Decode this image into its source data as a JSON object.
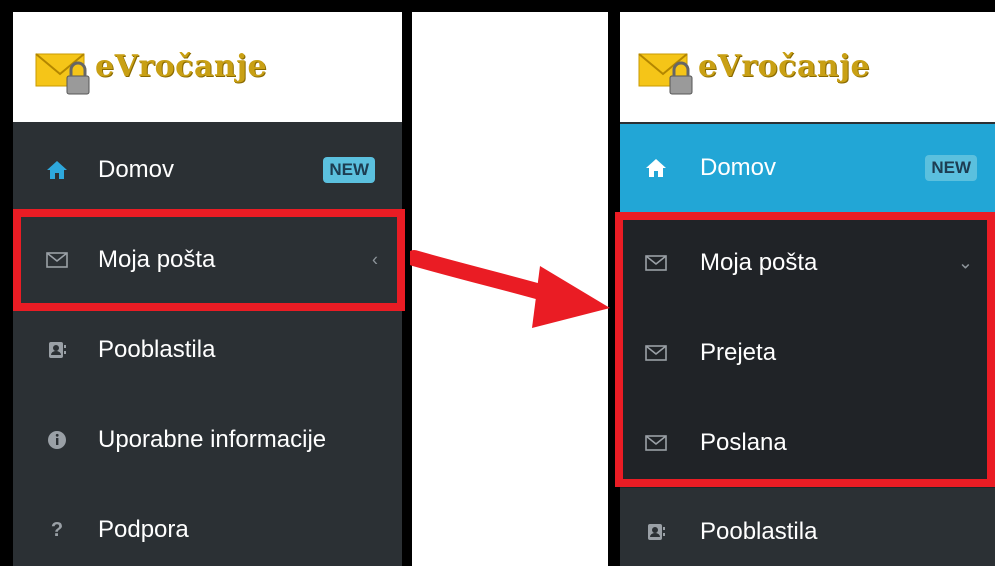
{
  "brand": {
    "name": "eVročanje",
    "logo_icon": "envelope-lock-icon"
  },
  "left_panel": {
    "items": [
      {
        "label": "Domov",
        "icon": "home-icon",
        "badge": "NEW"
      },
      {
        "label": "Moja pošta",
        "icon": "envelope-icon",
        "chevron": "‹"
      },
      {
        "label": "Pooblastila",
        "icon": "contact-card-icon"
      },
      {
        "label": "Uporabne informacije",
        "icon": "info-icon"
      },
      {
        "label": "Podpora",
        "icon": "question-icon"
      }
    ]
  },
  "right_panel": {
    "items": [
      {
        "label": "Domov",
        "icon": "home-icon",
        "badge": "NEW",
        "active": true
      },
      {
        "label": "Moja pošta",
        "icon": "envelope-icon",
        "chevron": "⌄"
      },
      {
        "label": "Prejeta",
        "icon": "envelope-icon"
      },
      {
        "label": "Poslana",
        "icon": "envelope-icon"
      },
      {
        "label": "Pooblastila",
        "icon": "contact-card-icon"
      }
    ]
  },
  "colors": {
    "sidebar": "#2b3034",
    "submenu": "#202327",
    "active": "#22a6d6",
    "badge": "#5bc0de",
    "highlight": "#ea1c24",
    "brand_text": "#c9a014"
  }
}
